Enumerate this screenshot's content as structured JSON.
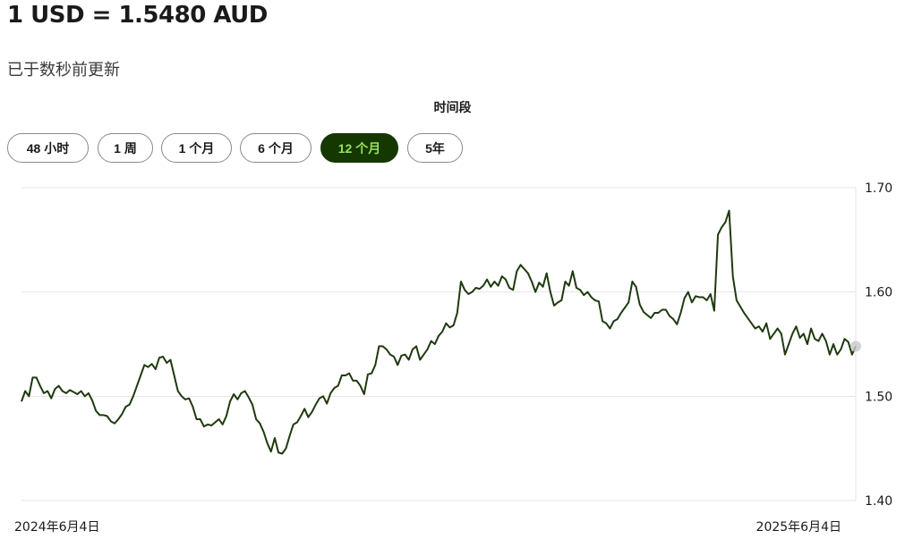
{
  "header": {
    "rate_text": "1 USD = 1.5480 AUD",
    "updated_text": "已于数秒前更新"
  },
  "periods": {
    "title": "时间段",
    "buttons": [
      {
        "label": "48 小时",
        "active": false
      },
      {
        "label": "1 周",
        "active": false
      },
      {
        "label": "1 个月",
        "active": false
      },
      {
        "label": "6 个月",
        "active": false
      },
      {
        "label": "12 个月",
        "active": true
      },
      {
        "label": "5年",
        "active": false
      }
    ]
  },
  "colors": {
    "line": "#1f3a10",
    "active_bg": "#143800",
    "active_text": "#9be15d",
    "grid": "#e6e6e6",
    "marker": "#c8c8c8"
  },
  "chart_data": {
    "type": "line",
    "series_label": "USD/AUD",
    "x_start_label": "2024年6月4日",
    "x_end_label": "2025年6月4日",
    "ylim": [
      1.4,
      1.7
    ],
    "yticks": [
      "1.70",
      "1.60",
      "1.50",
      "1.40"
    ],
    "grid": true,
    "y_axis_position": "right",
    "end_marker": true,
    "values": [
      1.495,
      1.505,
      1.5,
      1.518,
      1.518,
      1.51,
      1.503,
      1.505,
      1.498,
      1.507,
      1.51,
      1.505,
      1.503,
      1.506,
      1.504,
      1.502,
      1.505,
      1.5,
      1.503,
      1.496,
      1.486,
      1.482,
      1.482,
      1.481,
      1.476,
      1.474,
      1.478,
      1.483,
      1.49,
      1.492,
      1.5,
      1.51,
      1.52,
      1.53,
      1.528,
      1.531,
      1.526,
      1.537,
      1.538,
      1.532,
      1.535,
      1.52,
      1.505,
      1.5,
      1.497,
      1.498,
      1.49,
      1.478,
      1.478,
      1.471,
      1.473,
      1.472,
      1.475,
      1.478,
      1.473,
      1.481,
      1.495,
      1.502,
      1.497,
      1.503,
      1.505,
      1.499,
      1.492,
      1.478,
      1.474,
      1.466,
      1.455,
      1.447,
      1.46,
      1.446,
      1.445,
      1.45,
      1.462,
      1.473,
      1.475,
      1.481,
      1.488,
      1.48,
      1.485,
      1.492,
      1.498,
      1.5,
      1.493,
      1.503,
      1.508,
      1.51,
      1.52,
      1.52,
      1.522,
      1.515,
      1.515,
      1.51,
      1.502,
      1.521,
      1.522,
      1.53,
      1.548,
      1.548,
      1.545,
      1.54,
      1.538,
      1.53,
      1.539,
      1.54,
      1.535,
      1.545,
      1.548,
      1.535,
      1.54,
      1.545,
      1.553,
      1.55,
      1.558,
      1.562,
      1.57,
      1.566,
      1.568,
      1.58,
      1.61,
      1.602,
      1.598,
      1.6,
      1.604,
      1.603,
      1.606,
      1.612,
      1.605,
      1.61,
      1.606,
      1.615,
      1.612,
      1.604,
      1.602,
      1.62,
      1.626,
      1.622,
      1.618,
      1.61,
      1.6,
      1.609,
      1.605,
      1.618,
      1.6,
      1.587,
      1.59,
      1.592,
      1.61,
      1.606,
      1.62,
      1.604,
      1.602,
      1.597,
      1.6,
      1.595,
      1.592,
      1.591,
      1.572,
      1.57,
      1.565,
      1.572,
      1.574,
      1.58,
      1.585,
      1.59,
      1.61,
      1.605,
      1.588,
      1.581,
      1.578,
      1.575,
      1.58,
      1.58,
      1.583,
      1.583,
      1.577,
      1.574,
      1.569,
      1.58,
      1.594,
      1.6,
      1.59,
      1.596,
      1.595,
      1.595,
      1.592,
      1.598,
      1.582,
      1.655,
      1.662,
      1.667,
      1.678,
      1.615,
      1.592,
      1.586,
      1.58,
      1.575,
      1.57,
      1.565,
      1.567,
      1.562,
      1.57,
      1.555,
      1.56,
      1.565,
      1.56,
      1.54,
      1.55,
      1.56,
      1.567,
      1.556,
      1.56,
      1.55,
      1.565,
      1.555,
      1.553,
      1.56,
      1.553,
      1.54,
      1.55,
      1.54,
      1.545,
      1.555,
      1.552,
      1.54,
      1.548
    ]
  }
}
